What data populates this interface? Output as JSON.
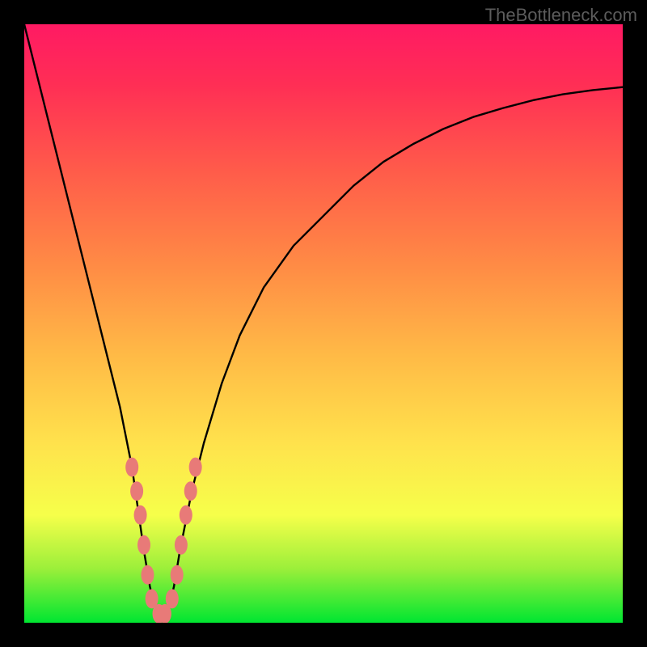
{
  "watermark": "TheBottleneck.com",
  "chart_data": {
    "type": "line",
    "title": "",
    "xlabel": "",
    "ylabel": "",
    "xlim": [
      0,
      100
    ],
    "ylim": [
      0,
      100
    ],
    "grid": false,
    "legend": false,
    "series": [
      {
        "name": "bottleneck-curve",
        "x": [
          0,
          2,
          4,
          6,
          8,
          10,
          12,
          14,
          16,
          18,
          20,
          21,
          22,
          23,
          24,
          25,
          26,
          28,
          30,
          33,
          36,
          40,
          45,
          50,
          55,
          60,
          65,
          70,
          75,
          80,
          85,
          90,
          95,
          100
        ],
        "values": [
          100,
          92,
          84,
          76,
          68,
          60,
          52,
          44,
          36,
          26,
          12,
          6,
          2,
          1,
          2,
          6,
          12,
          22,
          30,
          40,
          48,
          56,
          63,
          68,
          73,
          77,
          80,
          82.5,
          84.5,
          86,
          87.3,
          88.3,
          89,
          89.5
        ]
      }
    ],
    "markers": {
      "name": "highlight-dots",
      "color": "#e87a78",
      "points": [
        {
          "x": 18.0,
          "y": 26
        },
        {
          "x": 18.8,
          "y": 22
        },
        {
          "x": 19.4,
          "y": 18
        },
        {
          "x": 20.0,
          "y": 13
        },
        {
          "x": 20.6,
          "y": 8
        },
        {
          "x": 21.3,
          "y": 4
        },
        {
          "x": 22.5,
          "y": 1.5
        },
        {
          "x": 23.5,
          "y": 1.5
        },
        {
          "x": 24.7,
          "y": 4
        },
        {
          "x": 25.5,
          "y": 8
        },
        {
          "x": 26.2,
          "y": 13
        },
        {
          "x": 27.0,
          "y": 18
        },
        {
          "x": 27.8,
          "y": 22
        },
        {
          "x": 28.6,
          "y": 26
        }
      ]
    },
    "background_gradient": {
      "bottom": "#00e631",
      "mid": "#ffe24c",
      "top": "#ff1a63"
    }
  }
}
